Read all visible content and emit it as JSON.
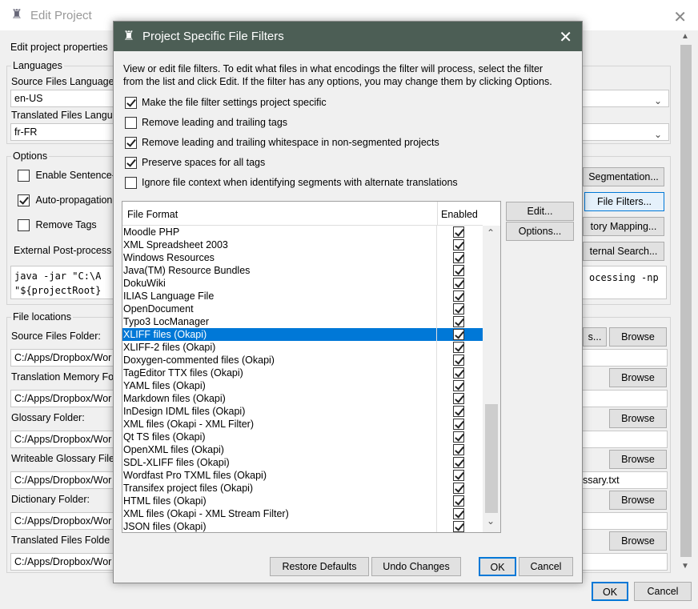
{
  "back": {
    "title": "Edit Project",
    "subtitle": "Edit project properties",
    "languages": {
      "group": "Languages",
      "source_label": "Source Files Language",
      "source_value": "en-US",
      "target_label": "Translated Files Langu",
      "target_value": "fr-FR"
    },
    "options": {
      "group": "Options",
      "enable_sentence": "Enable Sentence-",
      "auto_propagation": "Auto-propagation",
      "remove_tags": "Remove Tags",
      "external_post": "External Post-process",
      "cmd_line1": "java -jar \"C:\\A",
      "cmd_line2": "\"${projectRoot}",
      "cmd_right": "ocessing -np",
      "segmentation_button": "Segmentation...",
      "file_filters_button": "File Filters...",
      "tory_mapping_button": "tory Mapping...",
      "ternal_search_button": "ternal Search..."
    },
    "file_locations": {
      "group": "File locations",
      "source_folder_label": "Source Files Folder:",
      "tm_label": "Translation Memory Fo",
      "glossary_label": "Glossary Folder:",
      "writeable_glossary_label": "Writeable Glossary File",
      "dictionary_label": "Dictionary Folder:",
      "translated_label": "Translated Files Folde",
      "path_value": "C:/Apps/Dropbox/Wor",
      "glossary_file_tail": "ssary.txt",
      "partial_button": "s...",
      "browse": "Browse"
    },
    "ok": "OK",
    "cancel": "Cancel"
  },
  "dialog": {
    "title": "Project Specific File Filters",
    "description_line1": "View or edit file filters. To edit what files in what encodings the filter will process, select the filter",
    "description_line2": "from the list and click Edit. If the filter has any options, you may change them by clicking Options.",
    "options": [
      {
        "label": "Make the file filter settings project specific",
        "checked": true
      },
      {
        "label": "Remove leading and trailing tags",
        "checked": false
      },
      {
        "label": "Remove leading and trailing whitespace in non-segmented projects",
        "checked": true
      },
      {
        "label": "Preserve spaces for all tags",
        "checked": true
      },
      {
        "label": "Ignore file context when identifying segments with alternate translations",
        "checked": false
      }
    ],
    "table": {
      "col_format": "File Format",
      "col_enabled": "Enabled",
      "rows": [
        {
          "name": "Moodle PHP",
          "enabled": true
        },
        {
          "name": "XML Spreadsheet 2003",
          "enabled": true
        },
        {
          "name": "Windows Resources",
          "enabled": true
        },
        {
          "name": "Java(TM) Resource Bundles",
          "enabled": true
        },
        {
          "name": "DokuWiki",
          "enabled": true
        },
        {
          "name": "ILIAS Language File",
          "enabled": true
        },
        {
          "name": "OpenDocument",
          "enabled": true
        },
        {
          "name": "Typo3 LocManager",
          "enabled": true
        },
        {
          "name": "XLIFF files (Okapi)",
          "enabled": true,
          "selected": true
        },
        {
          "name": "XLIFF-2 files (Okapi)",
          "enabled": true
        },
        {
          "name": "Doxygen-commented files (Okapi)",
          "enabled": true
        },
        {
          "name": "TagEditor TTX files (Okapi)",
          "enabled": true
        },
        {
          "name": "YAML files (Okapi)",
          "enabled": true
        },
        {
          "name": "Markdown files (Okapi)",
          "enabled": true
        },
        {
          "name": "InDesign IDML files (Okapi)",
          "enabled": true
        },
        {
          "name": "XML files (Okapi - XML Filter)",
          "enabled": true
        },
        {
          "name": "Qt TS files (Okapi)",
          "enabled": true
        },
        {
          "name": "OpenXML files (Okapi)",
          "enabled": true
        },
        {
          "name": "SDL-XLIFF files (Okapi)",
          "enabled": true
        },
        {
          "name": "Wordfast Pro TXML files (Okapi)",
          "enabled": true
        },
        {
          "name": "Transifex project files (Okapi)",
          "enabled": true
        },
        {
          "name": "HTML files (Okapi)",
          "enabled": true
        },
        {
          "name": "XML files (Okapi - XML Stream Filter)",
          "enabled": true
        },
        {
          "name": "JSON files (Okapi)",
          "enabled": true
        }
      ]
    },
    "edit_button": "Edit...",
    "options_button": "Options...",
    "restore_defaults": "Restore Defaults",
    "undo_changes": "Undo Changes",
    "ok": "OK",
    "cancel": "Cancel"
  }
}
